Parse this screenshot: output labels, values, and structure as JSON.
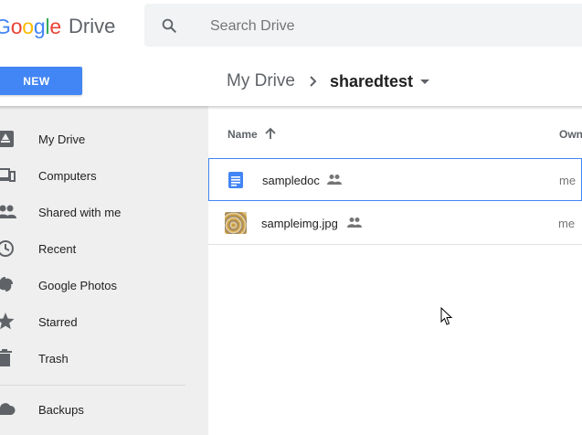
{
  "app": {
    "logo_google_letters": [
      {
        "ch": "G",
        "color": "#4285f4"
      },
      {
        "ch": "o",
        "color": "#ea4335"
      },
      {
        "ch": "o",
        "color": "#fbbc05"
      },
      {
        "ch": "g",
        "color": "#4285f4"
      },
      {
        "ch": "l",
        "color": "#34a853"
      },
      {
        "ch": "e",
        "color": "#ea4335"
      }
    ],
    "logo_product": "Drive"
  },
  "search": {
    "placeholder": "Search Drive",
    "icon": "search-icon"
  },
  "new_button": {
    "label": "NEW",
    "color": "#4285f4"
  },
  "breadcrumb": {
    "root": "My Drive",
    "current": "sharedtest"
  },
  "sidebar": {
    "items": [
      {
        "label": "My Drive",
        "icon": "my-drive-icon"
      },
      {
        "label": "Computers",
        "icon": "computers-icon"
      },
      {
        "label": "Shared with me",
        "icon": "shared-with-me-icon"
      },
      {
        "label": "Recent",
        "icon": "recent-icon"
      },
      {
        "label": "Google Photos",
        "icon": "google-photos-icon"
      },
      {
        "label": "Starred",
        "icon": "starred-icon"
      },
      {
        "label": "Trash",
        "icon": "trash-icon"
      },
      {
        "label": "Backups",
        "icon": "backups-icon"
      }
    ]
  },
  "file_list": {
    "columns": {
      "name": "Name",
      "owner": "Own"
    },
    "sort": "ascending",
    "rows": [
      {
        "name": "sampledoc",
        "type": "document",
        "shared": true,
        "owner": "me",
        "selected": true
      },
      {
        "name": "sampleimg.jpg",
        "type": "image",
        "shared": true,
        "owner": "me",
        "selected": false
      }
    ]
  },
  "colors": {
    "accent": "#4285f4",
    "sidebar_bg": "#efefef",
    "doc_icon": "#4285f4"
  }
}
